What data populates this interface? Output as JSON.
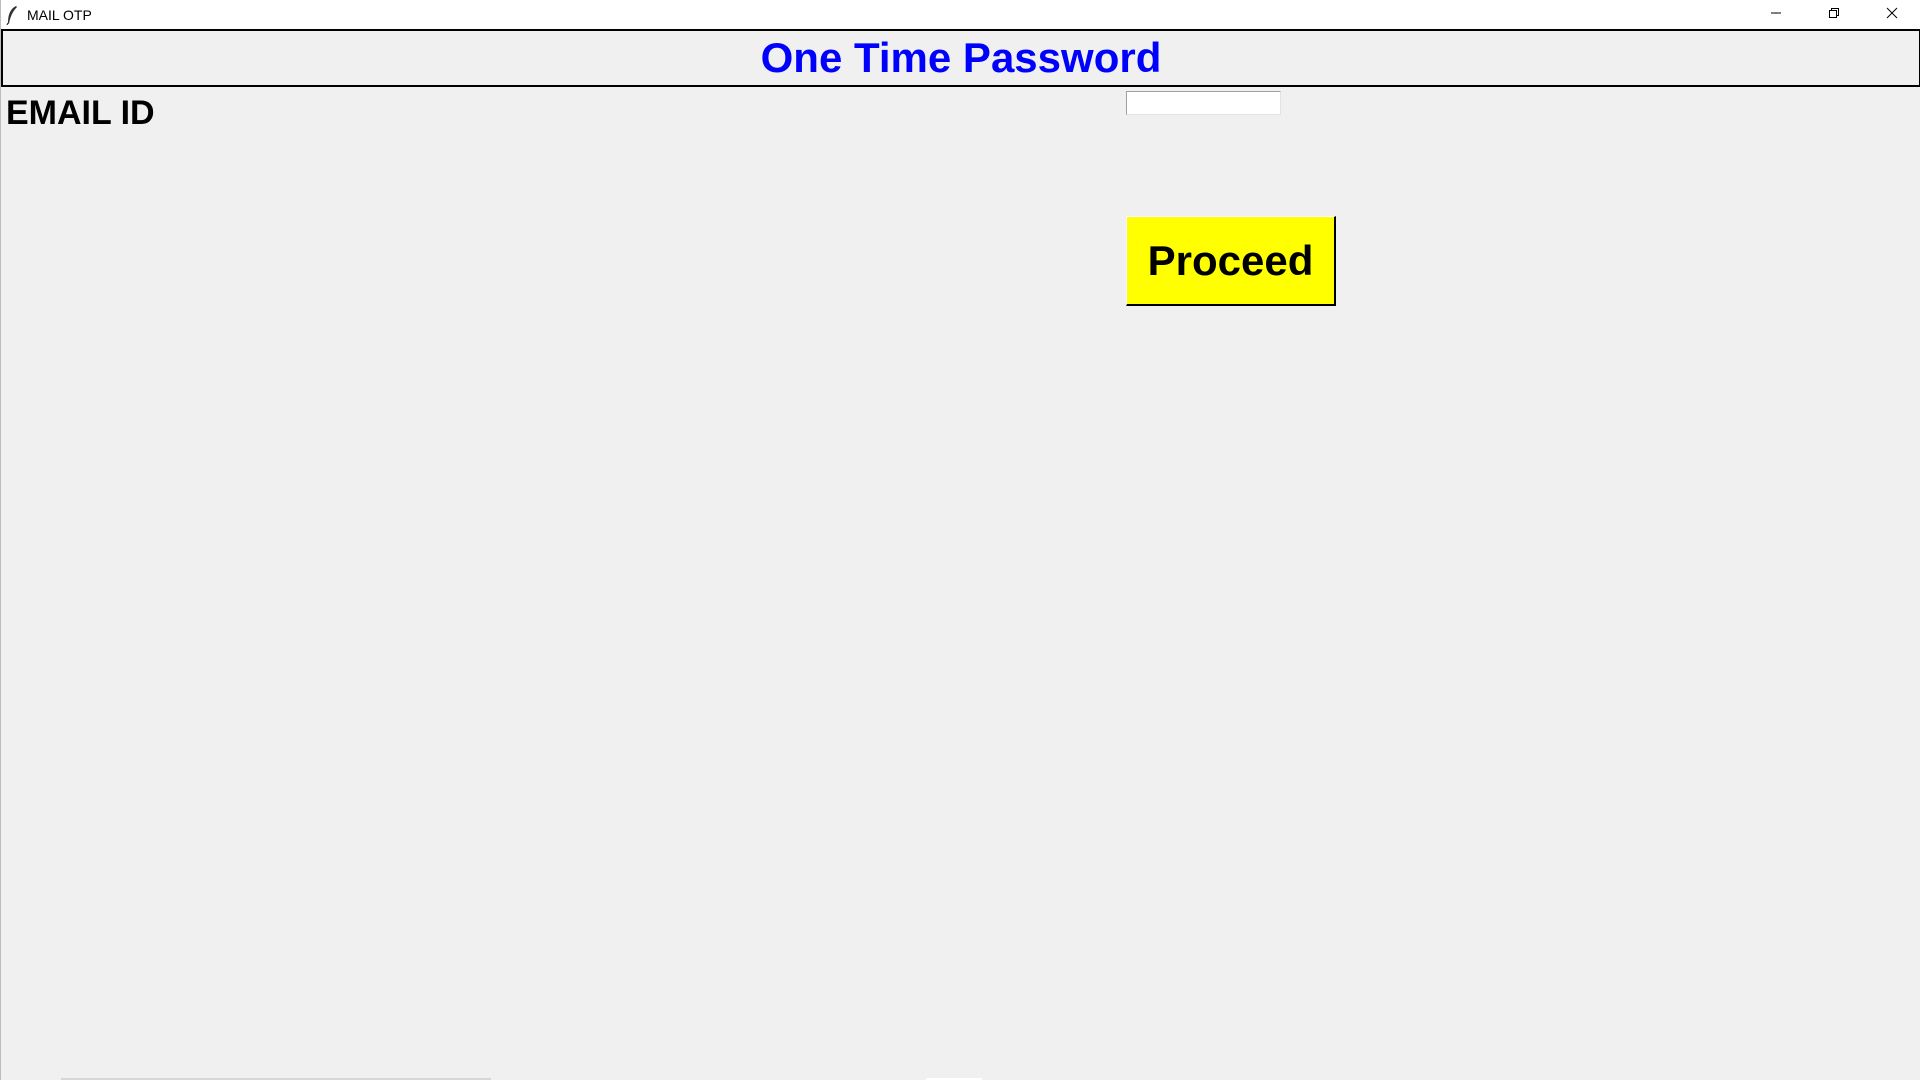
{
  "window": {
    "title": "MAIL OTP",
    "icon": "feather-icon",
    "controls": {
      "minimize": "minimize-icon",
      "maximize": "restore-icon",
      "close": "close-icon"
    }
  },
  "header": {
    "title": "One Time Password",
    "title_color": "#0000ff"
  },
  "form": {
    "email_label": "EMAIL ID",
    "email_value": "",
    "proceed_label": "Proceed",
    "proceed_color": "#ffff00"
  }
}
